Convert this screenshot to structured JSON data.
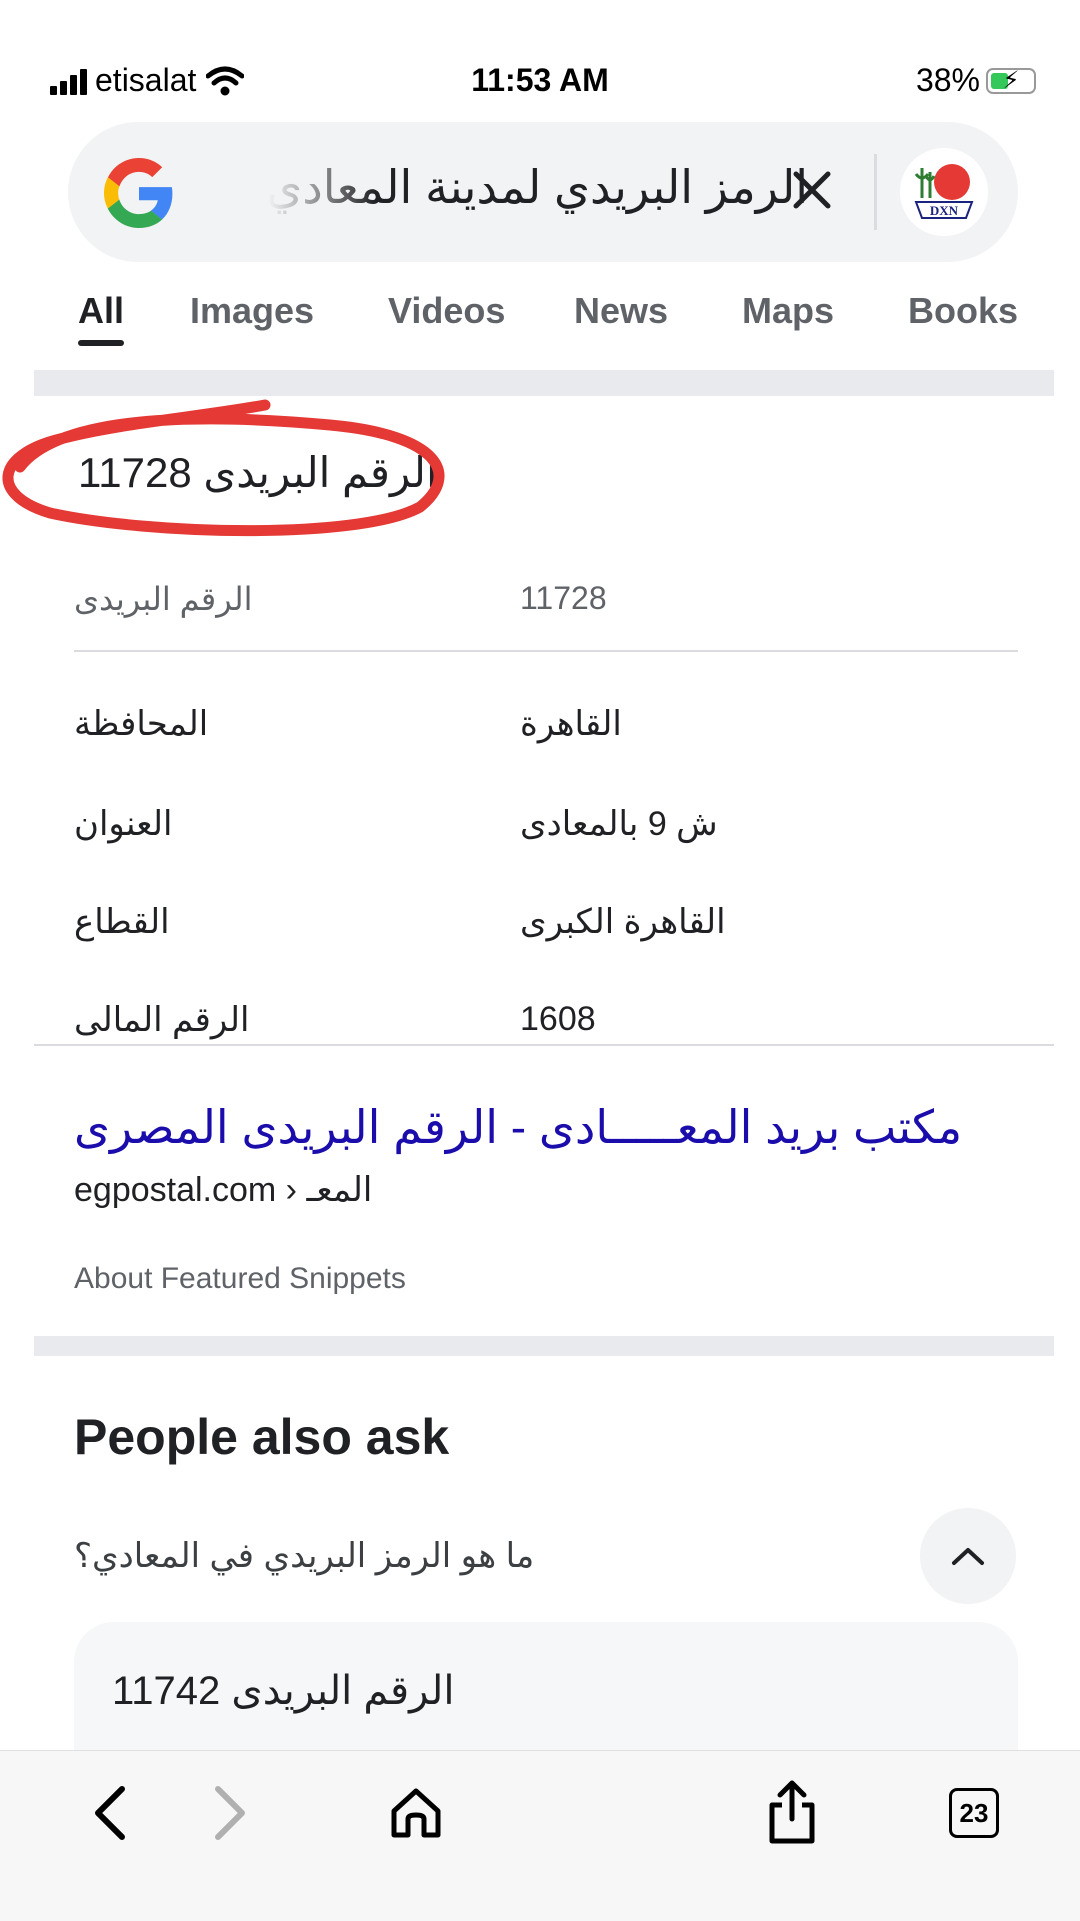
{
  "status_bar": {
    "carrier": "etisalat",
    "time": "11:53 AM",
    "battery": "38%"
  },
  "search": {
    "query": "الرمز البريدي لمدينة المعادي",
    "avatar_label": "DXN"
  },
  "tabs": [
    {
      "label": "All",
      "selected": true
    },
    {
      "label": "Images"
    },
    {
      "label": "Videos"
    },
    {
      "label": "News"
    },
    {
      "label": "Maps"
    },
    {
      "label": "Books"
    }
  ],
  "snippet": {
    "answer": "الرقم البريدى 11728",
    "header": {
      "label": "الرقم البريدى",
      "value": "11728"
    },
    "rows": [
      {
        "label": "المحافظة",
        "value": "القاهرة"
      },
      {
        "label": "العنوان",
        "value": "ش 9 بالمعادى"
      },
      {
        "label": "القطاع",
        "value": "القاهرة الكبرى"
      },
      {
        "label": "الرقم المالى",
        "value": "1608"
      }
    ],
    "result_title": "مكتب بريد المعـــــادى - الرقم البريدى المصرى",
    "result_url": "egpostal.com › المعـ",
    "about": "About Featured Snippets"
  },
  "people_also_ask": {
    "title": "People also ask",
    "question": "ما هو الرمز البريدي في المعادي؟",
    "answer": "الرقم البريدى 11742"
  },
  "toolbar": {
    "tabs_count": "23"
  },
  "colors": {
    "link": "#1a0dab",
    "highlight": "#e53935",
    "search_bg": "#f1f3f4"
  }
}
